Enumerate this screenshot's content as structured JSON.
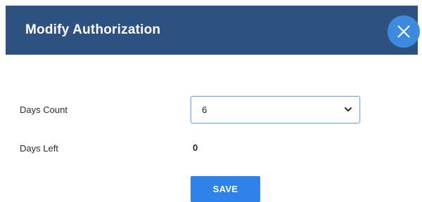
{
  "dialog": {
    "title": "Modify Authorization",
    "close_icon": "close-icon"
  },
  "form": {
    "days_count": {
      "label": "Days Count",
      "selected_value": "6",
      "chevron_icon": "chevron-down-icon"
    },
    "days_left": {
      "label": "Days Left",
      "value": "0"
    },
    "save_label": "SAVE"
  },
  "colors": {
    "header_bg": "#2e5180",
    "close_button": "#3d8be0",
    "save_button": "#2f83e8",
    "select_border": "#7fa7dd"
  }
}
